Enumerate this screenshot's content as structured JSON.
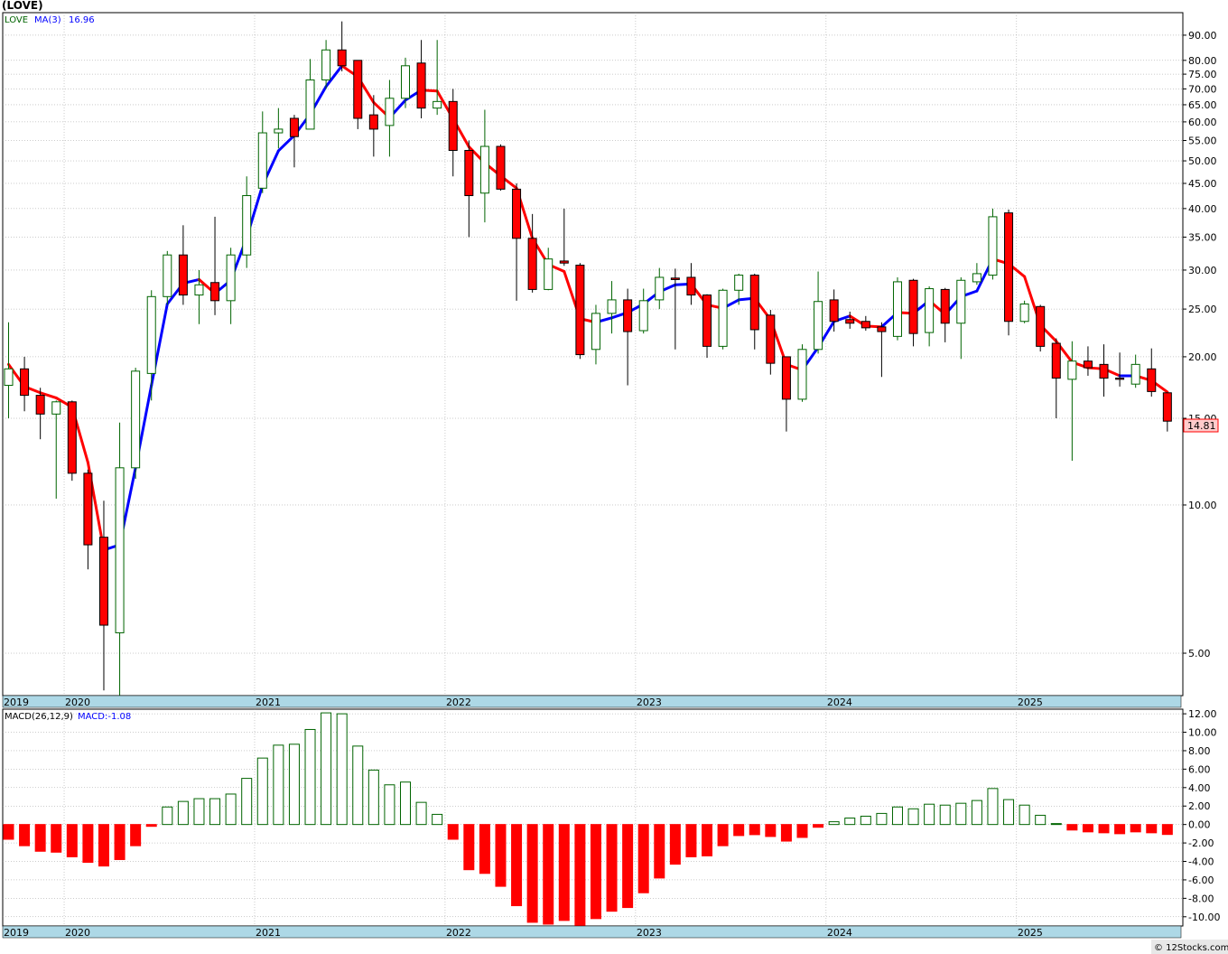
{
  "title": "(LOVE)",
  "legend": {
    "ticker": "LOVE",
    "ma_label": "MA(3)",
    "ma_value": "16.96",
    "macd_label": "MACD(26,12,9)",
    "macd_value": "MACD:-1.08"
  },
  "last_price_tag": "14.81",
  "watermark": "© 12Stocks.com",
  "colors": {
    "up_candle": "#006400",
    "down_candle": "#ff0000",
    "ma_rising": "#0000ff",
    "ma_falling": "#ff0000",
    "time_band": "#add8e6"
  },
  "chart_data": [
    {
      "type": "candlestick",
      "name": "LOVE",
      "scale": "log",
      "ylim": [
        4.1,
        100
      ],
      "yticks": [
        5.0,
        10.0,
        15.0,
        20.0,
        25.0,
        30.0,
        35.0,
        40.0,
        45.0,
        50.0,
        55.0,
        60.0,
        65.0,
        70.0,
        75.0,
        80.0,
        90.0
      ],
      "ytick_labels": [
        "5.00",
        "10.00",
        "15.00",
        "20.00",
        "25.00",
        "30.00",
        "35.00",
        "40.00",
        "45.00",
        "50.00",
        "55.00",
        "60.00",
        "65.00",
        "70.00",
        "75.00",
        "80.00",
        "90.00"
      ],
      "x_labels": [
        {
          "label": "2019",
          "month_index": 0
        },
        {
          "label": "2020",
          "month_index": 4
        },
        {
          "label": "2021",
          "month_index": 16
        },
        {
          "label": "2022",
          "month_index": 28
        },
        {
          "label": "2023",
          "month_index": 40
        },
        {
          "label": "2024",
          "month_index": 52
        },
        {
          "label": "2025",
          "month_index": 64
        }
      ],
      "candles": [
        {
          "o": 17.5,
          "h": 23.5,
          "l": 15.0,
          "c": 18.9
        },
        {
          "o": 18.9,
          "h": 20.0,
          "l": 15.5,
          "c": 16.7
        },
        {
          "o": 16.7,
          "h": 17.3,
          "l": 13.6,
          "c": 15.3
        },
        {
          "o": 15.3,
          "h": 16.3,
          "l": 10.3,
          "c": 16.2
        },
        {
          "o": 16.2,
          "h": 16.3,
          "l": 11.2,
          "c": 11.6
        },
        {
          "o": 11.6,
          "h": 11.8,
          "l": 7.4,
          "c": 8.3
        },
        {
          "o": 8.6,
          "h": 10.2,
          "l": 4.2,
          "c": 5.7
        },
        {
          "o": 5.5,
          "h": 14.7,
          "l": 4.1,
          "c": 11.9
        },
        {
          "o": 11.9,
          "h": 19.0,
          "l": 11.3,
          "c": 18.7
        },
        {
          "o": 18.5,
          "h": 27.3,
          "l": 16.3,
          "c": 26.5
        },
        {
          "o": 26.5,
          "h": 32.8,
          "l": 25.5,
          "c": 32.2
        },
        {
          "o": 32.2,
          "h": 37.0,
          "l": 25.5,
          "c": 26.7
        },
        {
          "o": 26.7,
          "h": 30.0,
          "l": 23.3,
          "c": 28.0
        },
        {
          "o": 28.3,
          "h": 38.5,
          "l": 24.3,
          "c": 26.0
        },
        {
          "o": 26.0,
          "h": 33.3,
          "l": 23.3,
          "c": 32.2
        },
        {
          "o": 32.2,
          "h": 46.5,
          "l": 30.3,
          "c": 42.5
        },
        {
          "o": 44.0,
          "h": 63.0,
          "l": 43.0,
          "c": 57.0
        },
        {
          "o": 57.0,
          "h": 64.0,
          "l": 53.0,
          "c": 58.0
        },
        {
          "o": 61.0,
          "h": 62.0,
          "l": 48.5,
          "c": 56.0
        },
        {
          "o": 58.0,
          "h": 80.5,
          "l": 58.0,
          "c": 73.0
        },
        {
          "o": 73.0,
          "h": 88.0,
          "l": 70.0,
          "c": 84.0
        },
        {
          "o": 84.0,
          "h": 96.0,
          "l": 76.0,
          "c": 78.0
        },
        {
          "o": 80.0,
          "h": 80.0,
          "l": 58.0,
          "c": 61.0
        },
        {
          "o": 62.0,
          "h": 68.0,
          "l": 51.0,
          "c": 58.0
        },
        {
          "o": 59.0,
          "h": 73.0,
          "l": 51.0,
          "c": 67.0
        },
        {
          "o": 67.0,
          "h": 81.0,
          "l": 64.0,
          "c": 78.0
        },
        {
          "o": 79.0,
          "h": 88.0,
          "l": 61.0,
          "c": 64.0
        },
        {
          "o": 64.0,
          "h": 88.0,
          "l": 62.0,
          "c": 66.0
        },
        {
          "o": 66.0,
          "h": 70.0,
          "l": 46.5,
          "c": 52.5
        },
        {
          "o": 52.5,
          "h": 55.0,
          "l": 35.0,
          "c": 42.5
        },
        {
          "o": 43.0,
          "h": 63.5,
          "l": 37.5,
          "c": 53.5
        },
        {
          "o": 53.5,
          "h": 54.0,
          "l": 43.5,
          "c": 43.8
        },
        {
          "o": 43.8,
          "h": 45.0,
          "l": 26.0,
          "c": 34.8
        },
        {
          "o": 34.8,
          "h": 39.0,
          "l": 27.0,
          "c": 27.4
        },
        {
          "o": 27.4,
          "h": 33.3,
          "l": 27.3,
          "c": 31.6
        },
        {
          "o": 31.3,
          "h": 40.0,
          "l": 30.6,
          "c": 31.0
        },
        {
          "o": 30.7,
          "h": 31.0,
          "l": 19.8,
          "c": 20.2
        },
        {
          "o": 20.7,
          "h": 25.5,
          "l": 19.3,
          "c": 24.5
        },
        {
          "o": 24.5,
          "h": 28.5,
          "l": 22.3,
          "c": 26.1
        },
        {
          "o": 26.1,
          "h": 27.5,
          "l": 17.5,
          "c": 22.5
        },
        {
          "o": 22.6,
          "h": 27.5,
          "l": 22.3,
          "c": 26.0
        },
        {
          "o": 26.1,
          "h": 30.3,
          "l": 25.0,
          "c": 29.0
        },
        {
          "o": 28.9,
          "h": 30.2,
          "l": 20.7,
          "c": 28.7
        },
        {
          "o": 29.0,
          "h": 31.0,
          "l": 25.5,
          "c": 26.7
        },
        {
          "o": 26.7,
          "h": 26.8,
          "l": 19.9,
          "c": 21.0
        },
        {
          "o": 21.0,
          "h": 27.5,
          "l": 20.7,
          "c": 27.3
        },
        {
          "o": 27.3,
          "h": 29.5,
          "l": 25.5,
          "c": 29.3
        },
        {
          "o": 29.3,
          "h": 29.5,
          "l": 20.7,
          "c": 22.7
        },
        {
          "o": 24.3,
          "h": 24.9,
          "l": 18.4,
          "c": 19.4
        },
        {
          "o": 20.0,
          "h": 20.0,
          "l": 14.1,
          "c": 16.4
        },
        {
          "o": 16.4,
          "h": 21.2,
          "l": 16.2,
          "c": 20.7
        },
        {
          "o": 20.7,
          "h": 29.8,
          "l": 20.3,
          "c": 25.9
        },
        {
          "o": 26.1,
          "h": 27.4,
          "l": 22.5,
          "c": 23.6
        },
        {
          "o": 23.8,
          "h": 24.7,
          "l": 22.8,
          "c": 23.4
        },
        {
          "o": 23.6,
          "h": 24.2,
          "l": 22.6,
          "c": 22.9
        },
        {
          "o": 23.0,
          "h": 23.5,
          "l": 18.2,
          "c": 22.5
        },
        {
          "o": 22.0,
          "h": 29.0,
          "l": 21.6,
          "c": 28.4
        },
        {
          "o": 28.6,
          "h": 28.8,
          "l": 21.0,
          "c": 22.3
        },
        {
          "o": 22.4,
          "h": 27.8,
          "l": 21.0,
          "c": 27.5
        },
        {
          "o": 27.4,
          "h": 27.6,
          "l": 21.4,
          "c": 23.4
        },
        {
          "o": 23.4,
          "h": 29.0,
          "l": 19.8,
          "c": 28.6
        },
        {
          "o": 28.4,
          "h": 31.0,
          "l": 28.0,
          "c": 29.5
        },
        {
          "o": 29.3,
          "h": 40.0,
          "l": 28.7,
          "c": 38.5
        },
        {
          "o": 39.2,
          "h": 39.8,
          "l": 22.1,
          "c": 23.6
        },
        {
          "o": 23.6,
          "h": 26.0,
          "l": 23.4,
          "c": 25.6
        },
        {
          "o": 25.3,
          "h": 25.5,
          "l": 20.5,
          "c": 21.0
        },
        {
          "o": 21.3,
          "h": 21.8,
          "l": 15.0,
          "c": 18.1
        },
        {
          "o": 18.0,
          "h": 21.5,
          "l": 12.3,
          "c": 19.6
        },
        {
          "o": 19.6,
          "h": 21.0,
          "l": 18.3,
          "c": 19.0
        },
        {
          "o": 19.3,
          "h": 21.2,
          "l": 16.6,
          "c": 18.1
        },
        {
          "o": 18.1,
          "h": 20.4,
          "l": 17.4,
          "c": 18.0
        },
        {
          "o": 17.6,
          "h": 20.2,
          "l": 17.3,
          "c": 19.3
        },
        {
          "o": 18.9,
          "h": 20.8,
          "l": 16.6,
          "c": 17.0
        },
        {
          "o": 16.9,
          "h": 16.9,
          "l": 14.1,
          "c": 14.8
        }
      ],
      "ma3": [
        19.3,
        17.4,
        16.9,
        16.5,
        15.8,
        12.2,
        8.1,
        8.3,
        11.9,
        17.5,
        25.6,
        28.2,
        28.7,
        26.9,
        28.6,
        34.9,
        44.6,
        52.4,
        56.3,
        62.2,
        70.8,
        78.0,
        74.1,
        65.7,
        61.2,
        66.4,
        69.6,
        69.3,
        60.9,
        53.4,
        49.5,
        46.6,
        44.0,
        34.8,
        30.8,
        29.8,
        23.9,
        23.5,
        24.0,
        24.6,
        25.6,
        27.1,
        28.0,
        28.1,
        25.5,
        25.1,
        26.1,
        26.3,
        23.8,
        19.3,
        18.8,
        20.9,
        23.6,
        24.2,
        23.1,
        23.0,
        24.6,
        24.5,
        26.0,
        24.4,
        26.5,
        27.2,
        31.6,
        30.9,
        29.1,
        23.2,
        21.5,
        19.5,
        19.0,
        18.9,
        18.3,
        18.3,
        17.9,
        16.96
      ]
    },
    {
      "type": "bar",
      "name": "MACD(26,12,9)",
      "ylim": [
        -11.0,
        12.5
      ],
      "yticks": [
        -10.0,
        -8.0,
        -6.0,
        -4.0,
        -2.0,
        0.0,
        2.0,
        4.0,
        6.0,
        8.0,
        10.0,
        12.0
      ],
      "ytick_labels": [
        "-10.00",
        "-8.00",
        "-6.00",
        "-4.00",
        "-2.00",
        "0.00",
        "2.00",
        "4.00",
        "6.00",
        "8.00",
        "10.00",
        "12.00"
      ],
      "values": [
        -1.6,
        -2.3,
        -2.9,
        -3.0,
        -3.5,
        -4.1,
        -4.5,
        -3.8,
        -2.3,
        -0.2,
        1.9,
        2.5,
        2.8,
        2.8,
        3.3,
        5.0,
        7.2,
        8.6,
        8.7,
        10.3,
        12.1,
        12.0,
        8.5,
        5.9,
        4.3,
        4.6,
        2.4,
        1.1,
        -1.6,
        -4.9,
        -5.3,
        -6.7,
        -8.8,
        -10.6,
        -10.8,
        -10.4,
        -11.0,
        -10.2,
        -9.4,
        -9.0,
        -7.4,
        -5.8,
        -4.3,
        -3.5,
        -3.4,
        -2.3,
        -1.2,
        -1.1,
        -1.3,
        -1.8,
        -1.4,
        -0.3,
        0.3,
        0.7,
        0.9,
        1.2,
        1.9,
        1.7,
        2.2,
        2.1,
        2.3,
        2.6,
        3.9,
        2.7,
        2.1,
        1.0,
        0.1,
        -0.6,
        -0.8,
        -0.9,
        -1.0,
        -0.8,
        -0.9,
        -1.08
      ]
    }
  ]
}
